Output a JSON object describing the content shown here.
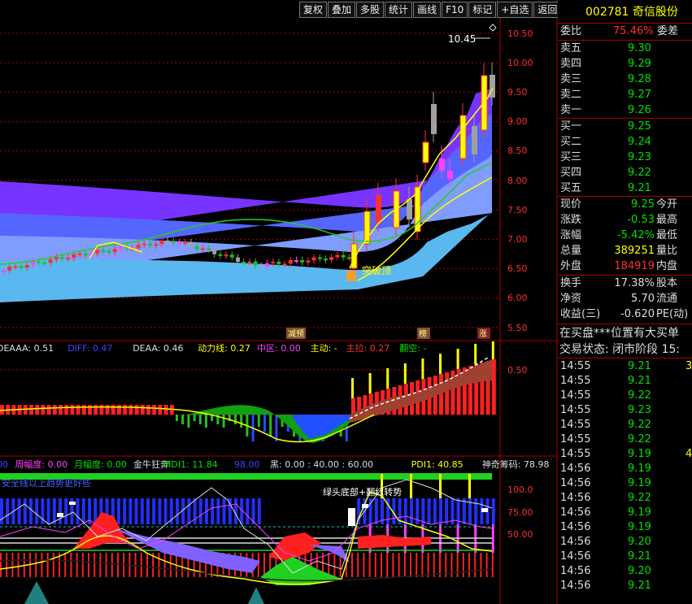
{
  "toolbar": [
    "复权",
    "叠加",
    "多股",
    "统计",
    "画线",
    "F10",
    "标记",
    "+自选",
    "返回"
  ],
  "stock": {
    "code": "002781",
    "name": "奇信股份"
  },
  "quote": {
    "webi_label": "委比",
    "webi_value": "75.46%",
    "weicha_label": "委差",
    "asks": [
      {
        "label": "卖五",
        "price": "9.30"
      },
      {
        "label": "卖四",
        "price": "9.29"
      },
      {
        "label": "卖三",
        "price": "9.28"
      },
      {
        "label": "卖二",
        "price": "9.27"
      },
      {
        "label": "卖一",
        "price": "9.26"
      }
    ],
    "bids": [
      {
        "label": "买一",
        "price": "9.25"
      },
      {
        "label": "买二",
        "price": "9.24"
      },
      {
        "label": "买三",
        "price": "9.23"
      },
      {
        "label": "买四",
        "price": "9.22"
      },
      {
        "label": "买五",
        "price": "9.21"
      }
    ],
    "stats": [
      {
        "label": "现价",
        "value": "9.25",
        "label2": "今开",
        "color": "green"
      },
      {
        "label": "涨跌",
        "value": "-0.53",
        "label2": "最高",
        "color": "green"
      },
      {
        "label": "涨幅",
        "value": "-5.42%",
        "label2": "最低",
        "color": "green"
      },
      {
        "label": "总量",
        "value": "389251",
        "label2": "量比",
        "color": "yellow"
      },
      {
        "label": "外盘",
        "value": "184919",
        "label2": "内盘",
        "color": "red"
      }
    ],
    "stats2": [
      {
        "label": "换手",
        "value": "17.38%",
        "label2": "股本"
      },
      {
        "label": "净资",
        "value": "5.70",
        "label2": "流通"
      },
      {
        "label": "收益(三)",
        "value": "-0.620",
        "label2": "PE(动)"
      }
    ],
    "notice": "在买盘***位置有大买单",
    "status": "交易状态: 闭市阶段 15:"
  },
  "ticks": [
    {
      "t": "14:55",
      "p": "9.21",
      "v": "3"
    },
    {
      "t": "14:55",
      "p": "9.21",
      "v": ""
    },
    {
      "t": "14:55",
      "p": "9.22",
      "v": ""
    },
    {
      "t": "14:55",
      "p": "9.23",
      "v": ""
    },
    {
      "t": "14:55",
      "p": "9.22",
      "v": ""
    },
    {
      "t": "14:55",
      "p": "9.22",
      "v": ""
    },
    {
      "t": "14:55",
      "p": "9.19",
      "v": "4"
    },
    {
      "t": "14:56",
      "p": "9.19",
      "v": ""
    },
    {
      "t": "14:56",
      "p": "9.19",
      "v": ""
    },
    {
      "t": "14:56",
      "p": "9.22",
      "v": ""
    },
    {
      "t": "14:56",
      "p": "9.19",
      "v": ""
    },
    {
      "t": "14:56",
      "p": "9.19",
      "v": ""
    },
    {
      "t": "14:56",
      "p": "9.20",
      "v": ""
    },
    {
      "t": "14:56",
      "p": "9.21",
      "v": ""
    },
    {
      "t": "14:56",
      "p": "9.20",
      "v": ""
    },
    {
      "t": "14:56",
      "p": "9.21",
      "v": ""
    }
  ],
  "main_chart": {
    "yaxis": [
      "10.50",
      "10.00",
      "9.50",
      "9.00",
      "8.50",
      "8.00",
      "7.50",
      "7.00",
      "6.50",
      "6.00",
      "5.50"
    ],
    "high_label": "10.45",
    "breakout_label": "突破顶",
    "markers": [
      "减预",
      "榜",
      "涨"
    ]
  },
  "macd_panel": {
    "items": [
      {
        "text": "DEAAA: 0.51",
        "color": "#dddddd"
      },
      {
        "text": "DIFF: 0.47",
        "color": "#4040ff"
      },
      {
        "text": "DEAA: 0.46",
        "color": "#dddddd"
      },
      {
        "text": "动力线: 0.27",
        "color": "#ffff00"
      },
      {
        "text": "中区: 0.00",
        "color": "#ff40ff"
      },
      {
        "text": "主动: -",
        "color": "#ffff00"
      },
      {
        "text": "主拉: 0.27",
        "color": "#ff3030"
      },
      {
        "text": "翻空: -",
        "color": "#00e000"
      }
    ],
    "yaxis": [
      "0.50"
    ]
  },
  "ind_panel": {
    "items": [
      {
        "text": "00",
        "color": "#4040ff"
      },
      {
        "text": "周幅度: 0.00",
        "color": "#ff40ff"
      },
      {
        "text": "月幅度: 0.00",
        "color": "#00e000"
      },
      {
        "text": "金牛狂奔",
        "color": "#dddddd"
      },
      {
        "text": "MDI1: 11.84",
        "color": "#00e000"
      },
      {
        "text": "98.00",
        "color": "#4040ff"
      },
      {
        "text": "黑: 0.00 : 40.00 : 60.00",
        "color": "#dddddd"
      },
      {
        "text": "PDI1: 40.85",
        "color": "#ffff00"
      },
      {
        "text": "神奇筹码: 78.98",
        "color": "#dddddd"
      }
    ],
    "overlay_text": "安全线以上趋势更好些",
    "annot": "绿头底部+翻红转势",
    "yaxis": [
      "100.0",
      "75.00",
      "50.00"
    ]
  },
  "colors": {
    "up": "#ff3030",
    "down": "#00c0c0",
    "ma_green": "#20d020",
    "ma_yellow": "#ffff00"
  }
}
